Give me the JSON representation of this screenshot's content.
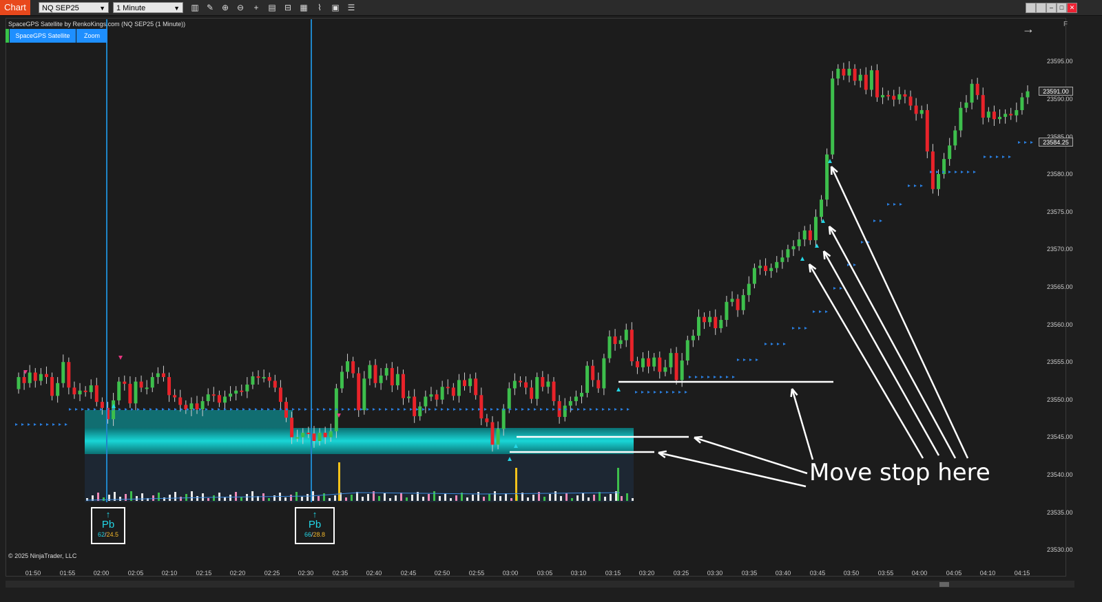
{
  "toolbar": {
    "chart_label": "Chart",
    "instrument": "NQ SEP25",
    "timeframe": "1 Minute",
    "tools": [
      "bar-type-icon",
      "draw-icon",
      "zoom-in-icon",
      "zoom-out-icon",
      "crosshair-icon",
      "properties-icon",
      "templates-icon",
      "strategy-icon",
      "indicator-icon",
      "data-box-icon",
      "list-icon"
    ]
  },
  "window_buttons": [
    "tile",
    "restore",
    "minimize",
    "maximize",
    "close"
  ],
  "chart": {
    "title": "SpaceGPS Satellite by RenkoKings.com (NQ SEP25 (1 Minute))",
    "indicator_buttons": [
      "SpaceGPS Satellite",
      "Zoom"
    ],
    "panel_label": "F",
    "copyright": "© 2025 NinjaTrader, LLC",
    "price_tags": [
      "23591.00",
      "23584.25"
    ],
    "y_axis": [
      "23595.00",
      "23590.00",
      "23585.00",
      "23580.00",
      "23575.00",
      "23570.00",
      "23565.00",
      "23560.00",
      "23555.00",
      "23550.00",
      "23545.00",
      "23540.00",
      "23535.00",
      "23530.00"
    ],
    "x_axis": [
      "01:50",
      "01:55",
      "02:00",
      "02:05",
      "02:10",
      "02:15",
      "02:20",
      "02:25",
      "02:30",
      "02:35",
      "02:40",
      "02:45",
      "02:50",
      "02:55",
      "03:00",
      "03:05",
      "03:10",
      "03:15",
      "03:20",
      "03:25",
      "03:30",
      "03:35",
      "03:40",
      "03:45",
      "03:50",
      "03:55",
      "04:00",
      "04:05",
      "04:10",
      "04:15"
    ],
    "signals": [
      {
        "label": "Pb",
        "v1": "62",
        "v2": "24.5"
      },
      {
        "label": "Pb",
        "v1": "66",
        "v2": "28.8"
      }
    ],
    "annotation": "Move stop here",
    "colors": {
      "up": "#3dbf4c",
      "down": "#e8232a",
      "zone": "#13b3b3",
      "dots": "#2a7fe0",
      "vline": "#1f86c9"
    }
  },
  "chart_data": {
    "type": "candlestick",
    "instrument": "NQ SEP25",
    "interval": "1 Minute",
    "ylim": [
      23528,
      23600
    ],
    "candles": [
      [
        23551.4,
        23553.0
      ],
      [
        23553.0,
        23552.2
      ],
      [
        23552.2,
        23553.6
      ],
      [
        23553.6,
        23552.5
      ],
      [
        23552.5,
        23553.4
      ],
      [
        23553.4,
        23553.0
      ],
      [
        23553.0,
        23550.5
      ],
      [
        23550.5,
        23552.2
      ],
      [
        23552.2,
        23555.0
      ],
      [
        23555.0,
        23551.6
      ],
      [
        23551.6,
        23550.7
      ],
      [
        23550.7,
        23551.2
      ],
      [
        23551.2,
        23551.0
      ],
      [
        23551.0,
        23551.9
      ],
      [
        23551.9,
        23549.7
      ],
      [
        23549.7,
        23548.9
      ],
      [
        23548.9,
        23547.4
      ],
      [
        23547.4,
        23549.9
      ],
      [
        23549.9,
        23552.4
      ],
      [
        23552.4,
        23552.1
      ],
      [
        23552.1,
        23549.5
      ],
      [
        23549.5,
        23552.4
      ],
      [
        23552.4,
        23551.6
      ],
      [
        23551.6,
        23551.6
      ],
      [
        23551.6,
        23553.0
      ],
      [
        23553.0,
        23553.5
      ],
      [
        23553.5,
        23553.0
      ],
      [
        23553.0,
        23550.6
      ],
      [
        23550.6,
        23550.3
      ],
      [
        23550.3,
        23549.3
      ],
      [
        23549.3,
        23548.7
      ],
      [
        23548.7,
        23549.5
      ],
      [
        23549.5,
        23548.7
      ],
      [
        23548.7,
        23549.8
      ],
      [
        23549.8,
        23550.7
      ],
      [
        23550.7,
        23550.6
      ],
      [
        23550.6,
        23549.6
      ],
      [
        23549.6,
        23550.4
      ],
      [
        23550.4,
        23550.8
      ],
      [
        23550.8,
        23551.2
      ],
      [
        23551.2,
        23551.1
      ],
      [
        23551.1,
        23552.0
      ],
      [
        23552.0,
        23553.1
      ],
      [
        23553.1,
        23552.9
      ],
      [
        23552.9,
        23553.0
      ],
      [
        23553.0,
        23552.5
      ],
      [
        23552.5,
        23551.6
      ],
      [
        23551.6,
        23549.7
      ],
      [
        23549.7,
        23547.6
      ],
      [
        23547.6,
        23545.0
      ],
      [
        23545.0,
        23545.0
      ],
      [
        23545.0,
        23545.6
      ],
      [
        23545.6,
        23545.5
      ],
      [
        23545.5,
        23544.5
      ],
      [
        23544.5,
        23545.6
      ],
      [
        23545.6,
        23545.0
      ],
      [
        23545.0,
        23545.8
      ],
      [
        23545.8,
        23551.5
      ],
      [
        23551.5,
        23553.7
      ],
      [
        23553.7,
        23555.1
      ],
      [
        23555.1,
        23553.5
      ],
      [
        23553.5,
        23548.6
      ],
      [
        23548.6,
        23552.8
      ],
      [
        23552.8,
        23554.6
      ],
      [
        23554.6,
        23552.2
      ],
      [
        23552.2,
        23553.2
      ],
      [
        23553.2,
        23554.2
      ],
      [
        23554.2,
        23551.9
      ],
      [
        23551.9,
        23553.4
      ],
      [
        23553.4,
        23550.2
      ],
      [
        23550.2,
        23550.4
      ],
      [
        23550.4,
        23547.8
      ],
      [
        23547.8,
        23549.1
      ],
      [
        23549.1,
        23550.4
      ],
      [
        23550.4,
        23550.7
      ],
      [
        23550.7,
        23550.0
      ],
      [
        23550.0,
        23551.7
      ],
      [
        23551.7,
        23551.6
      ],
      [
        23551.6,
        23550.5
      ],
      [
        23550.5,
        23552.6
      ],
      [
        23552.6,
        23551.8
      ],
      [
        23551.8,
        23552.8
      ],
      [
        23552.8,
        23550.6
      ],
      [
        23550.6,
        23547.5
      ],
      [
        23547.5,
        23547.0
      ],
      [
        23547.0,
        23544.0
      ],
      [
        23544.0,
        23546.1
      ],
      [
        23546.1,
        23548.8
      ],
      [
        23548.8,
        23551.5
      ],
      [
        23551.5,
        23552.5
      ],
      [
        23552.5,
        23552.3
      ],
      [
        23552.3,
        23551.6
      ],
      [
        23551.6,
        23550.1
      ],
      [
        23550.1,
        23553.0
      ],
      [
        23553.0,
        23551.7
      ],
      [
        23551.7,
        23552.4
      ],
      [
        23552.4,
        23549.8
      ],
      [
        23549.8,
        23547.7
      ],
      [
        23547.7,
        23549.2
      ],
      [
        23549.2,
        23549.8
      ],
      [
        23549.8,
        23550.4
      ],
      [
        23550.4,
        23550.9
      ],
      [
        23550.9,
        23554.5
      ],
      [
        23554.5,
        23552.6
      ],
      [
        23552.6,
        23551.5
      ],
      [
        23551.5,
        23555.5
      ],
      [
        23555.5,
        23558.4
      ],
      [
        23558.4,
        23557.4
      ],
      [
        23557.4,
        23557.9
      ],
      [
        23557.9,
        23559.3
      ],
      [
        23559.3,
        23555.1
      ],
      [
        23555.1,
        23554.3
      ],
      [
        23554.3,
        23555.5
      ],
      [
        23555.5,
        23554.4
      ],
      [
        23554.4,
        23555.6
      ],
      [
        23555.6,
        23553.7
      ],
      [
        23553.7,
        23554.3
      ],
      [
        23554.3,
        23556.2
      ],
      [
        23556.2,
        23552.6
      ],
      [
        23552.6,
        23555.2
      ],
      [
        23555.2,
        23557.9
      ],
      [
        23557.9,
        23558.5
      ],
      [
        23558.5,
        23561.0
      ],
      [
        23561.0,
        23560.3
      ],
      [
        23560.3,
        23561.0
      ],
      [
        23561.0,
        23559.5
      ],
      [
        23559.5,
        23560.6
      ],
      [
        23560.6,
        23563.0
      ],
      [
        23563.0,
        23563.4
      ],
      [
        23563.4,
        23561.9
      ],
      [
        23561.9,
        23563.9
      ],
      [
        23563.9,
        23565.4
      ],
      [
        23565.4,
        23567.5
      ],
      [
        23567.5,
        23567.8
      ],
      [
        23567.8,
        23567.1
      ],
      [
        23567.1,
        23567.5
      ],
      [
        23567.5,
        23568.3
      ],
      [
        23568.3,
        23568.9
      ],
      [
        23568.9,
        23570.0
      ],
      [
        23570.0,
        23570.4
      ],
      [
        23570.4,
        23571.3
      ],
      [
        23571.3,
        23572.5
      ],
      [
        23572.5,
        23571.2
      ],
      [
        23571.2,
        23574.3
      ],
      [
        23574.3,
        23576.6
      ],
      [
        23576.6,
        23582.6
      ],
      [
        23582.6,
        23592.7
      ],
      [
        23592.7,
        23594.0
      ],
      [
        23594.0,
        23593.1
      ],
      [
        23593.1,
        23594.0
      ],
      [
        23594.0,
        23592.4
      ],
      [
        23592.4,
        23593.2
      ],
      [
        23593.2,
        23591.2
      ],
      [
        23591.2,
        23593.8
      ],
      [
        23593.8,
        23590.2
      ],
      [
        23590.2,
        23590.5
      ],
      [
        23590.5,
        23590.4
      ],
      [
        23590.4,
        23589.9
      ],
      [
        23589.9,
        23590.6
      ],
      [
        23590.6,
        23590.3
      ],
      [
        23590.3,
        23589.1
      ],
      [
        23589.1,
        23588.0
      ],
      [
        23588.0,
        23588.5
      ],
      [
        23588.5,
        23583.0
      ],
      [
        23583.0,
        23578.0
      ],
      [
        23578.0,
        23580.0
      ],
      [
        23580.0,
        23582.0
      ],
      [
        23582.0,
        23583.8
      ],
      [
        23583.8,
        23585.8
      ],
      [
        23585.8,
        23588.8
      ],
      [
        23588.8,
        23589.5
      ],
      [
        23589.5,
        23592.0
      ],
      [
        23592.0,
        23590.5
      ],
      [
        23590.5,
        23587.5
      ],
      [
        23587.5,
        23588.3
      ],
      [
        23588.3,
        23587.3
      ],
      [
        23587.3,
        23587.6
      ],
      [
        23587.6,
        23588.0
      ],
      [
        23588.0,
        23587.8
      ],
      [
        23587.8,
        23588.5
      ],
      [
        23588.5,
        23590.2
      ],
      [
        23590.2,
        23591.0
      ]
    ]
  }
}
